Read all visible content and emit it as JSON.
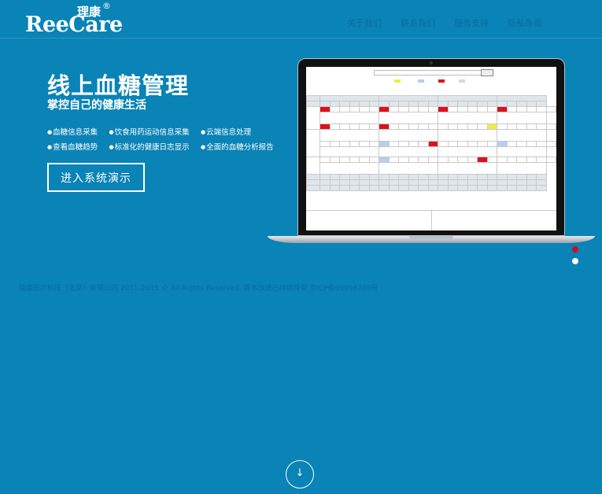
{
  "brand": {
    "name_en": "ReeCare",
    "name_cn": "理康",
    "reg": "®"
  },
  "nav": [
    "关于我们",
    "联系我们",
    "服务支持",
    "隐私条款"
  ],
  "hero": {
    "title": "线上血糖管理",
    "subtitle": "掌控自己的健康生活",
    "features": [
      "血糖信息采集",
      "饮食用药运动信息采集",
      "云端信息处理",
      "查看血糖趋势",
      "标准化的健康日志显示",
      "全面的血糖分析报告"
    ],
    "button": "进入系统演示"
  },
  "carousel": {
    "count": 2,
    "active_index": 0
  },
  "footer": {
    "copyright": "瑞康医疗科技（北京）有限公司 2011-2015 © All Rights Reserved. 版本改进已持续持有   京ICP备09098789号"
  },
  "scroll_icon": "chevron-double-down-icon",
  "colors": {
    "background": "#0a83b6",
    "accent": "#c8102e",
    "nav_text": "#056f9c"
  }
}
